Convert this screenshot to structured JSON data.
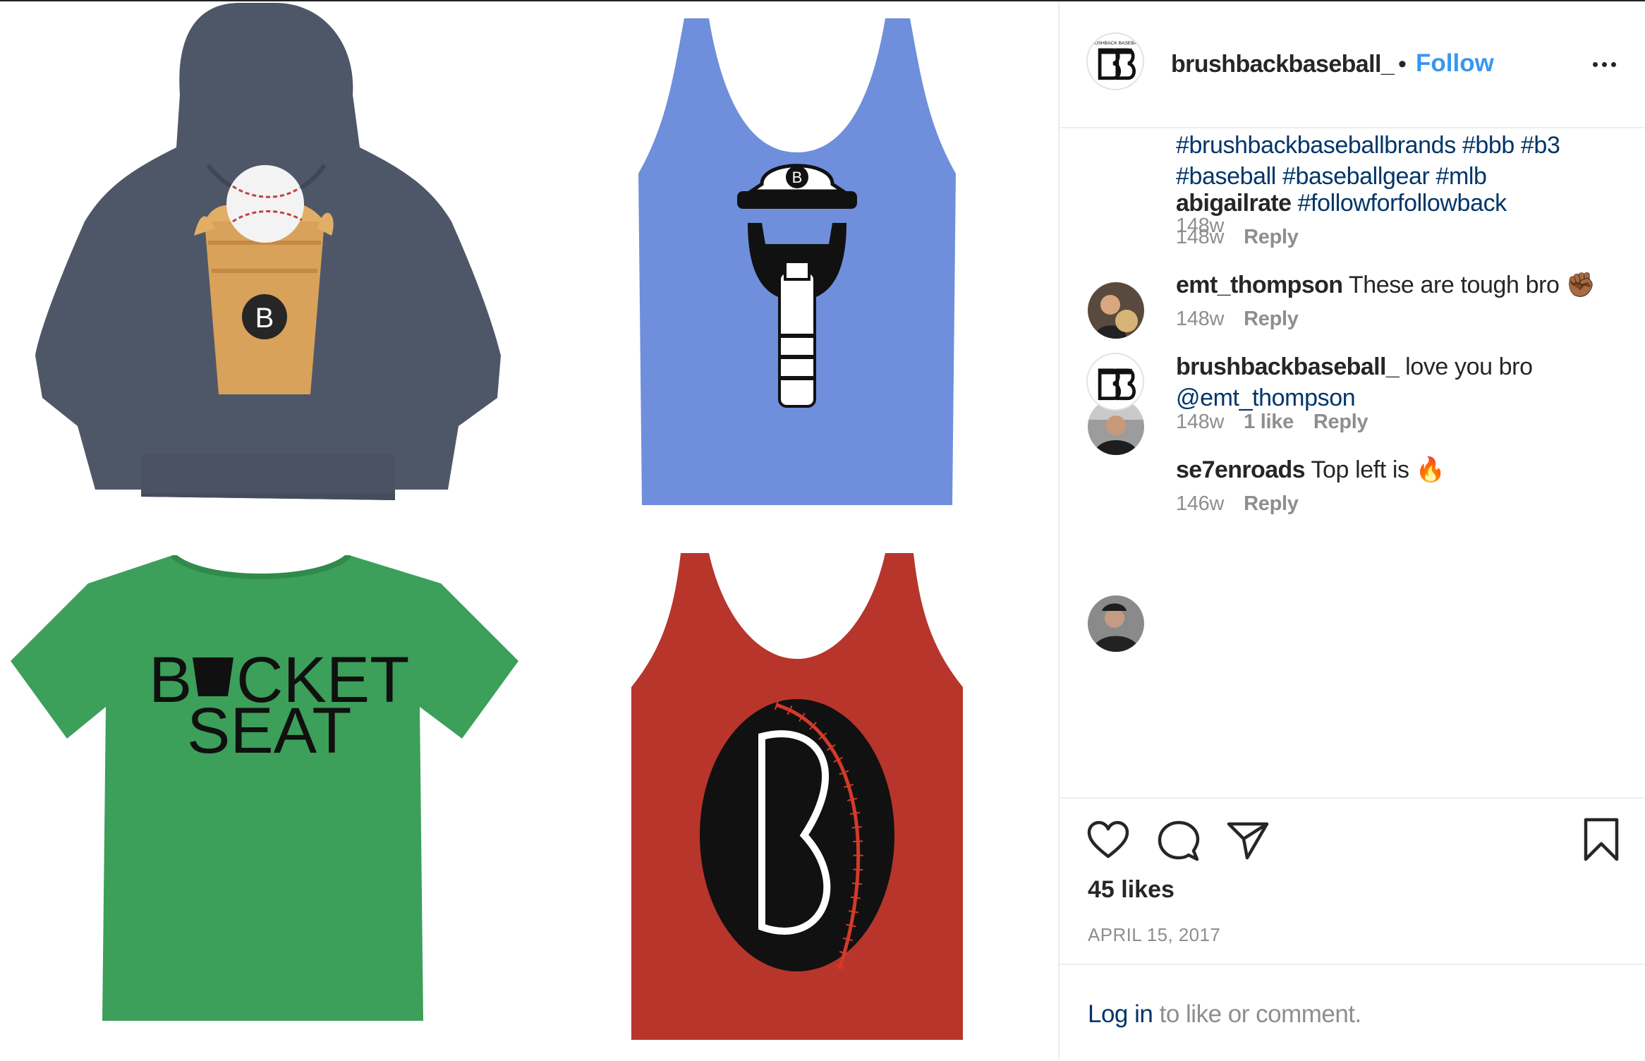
{
  "post": {
    "author": "brushbackbaseball_",
    "follow_label": "Follow",
    "separator": "•",
    "more_icon": "more-options-icon",
    "logo_text": "BRUSHBACK BASEBALL",
    "product_art": {
      "bucket_seat_line1": "B",
      "bucket_seat_line1b": "CKET",
      "bucket_seat_line2": "SEAT",
      "badge_letter": "B"
    }
  },
  "caption": {
    "hashtags_line1": "#brushbackbaseballbrands #bbb #b3",
    "hashtags_line2": "#baseball #baseballgear #mlb",
    "age": "148w"
  },
  "comments": [
    {
      "user": "abigailrate",
      "text": "#followforfollowback",
      "text_is_hashtag": true,
      "age": "148w",
      "reply_label": "Reply"
    },
    {
      "user": "emt_thompson",
      "text": "These are tough bro ✊🏾",
      "age": "148w",
      "reply_label": "Reply"
    },
    {
      "user": "brushbackbaseball_",
      "text": "love you bro",
      "mention": "@emt_thompson",
      "age": "148w",
      "likes": "1 like",
      "reply_label": "Reply"
    },
    {
      "user": "se7enroads",
      "text": "Top left is 🔥",
      "age": "146w",
      "reply_label": "Reply"
    }
  ],
  "actions": {
    "like_icon": "heart-icon",
    "comment_icon": "comment-icon",
    "share_icon": "share-icon",
    "save_icon": "bookmark-icon",
    "likes_count": "45 likes",
    "date": "APRIL 15, 2017"
  },
  "login": {
    "link": "Log in",
    "rest": " to like or comment."
  },
  "colors": {
    "follow": "#3897f0",
    "hashtag": "#003569",
    "hoodie": "#4e5767",
    "blue_tank": "#6f8fdd",
    "green_tee": "#3c9f5a",
    "red_tank": "#b7352b"
  }
}
